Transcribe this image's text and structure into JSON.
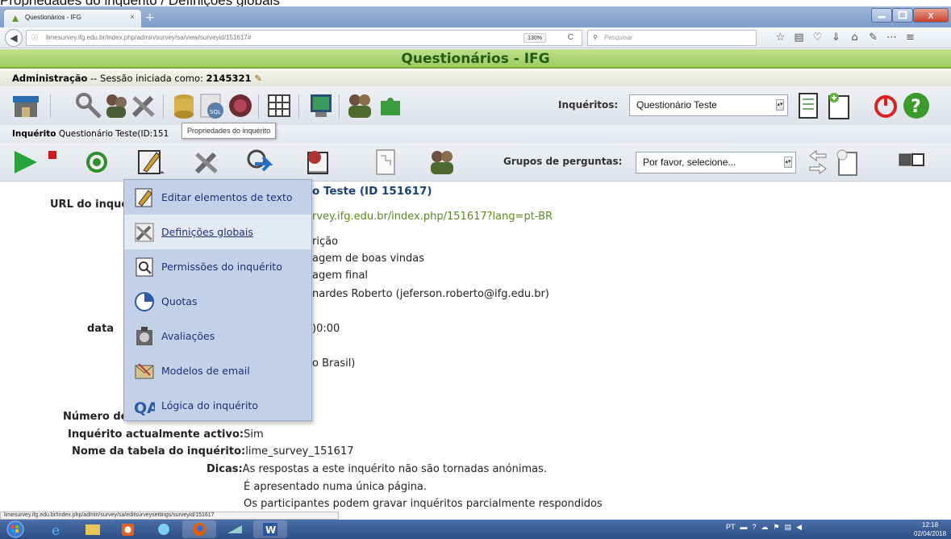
{
  "doc_caption": "Propriedades do inquérito / Definições globais",
  "browser": {
    "tab_title": "Questionários - IFG",
    "tab_close": "×",
    "new_tab": "+",
    "win_close": "x",
    "url": "limesurvey.ifg.edu.br/index.php/admin/survey/sa/view/surveyid/151617#",
    "zoom": "130%",
    "search_placeholder": "Pesquisar",
    "status_url": "limesurvey.ifg.edu.br/index.php/admin/survey/sa/editsurveysettings/surveyid/151617"
  },
  "app": {
    "title": "Questionários - IFG",
    "admin_prefix": "Administração",
    "session_text": "-- Sessão iniciada como:",
    "user_id": "2145321",
    "surveys_label": "Inquéritos:",
    "selected_survey": "Questionário Teste",
    "survey_line_prefix": "Inquérito",
    "survey_line_value": "Questionário Teste(ID:151",
    "tooltip": "Propriedades do inquérito",
    "groups_label": "Grupos de perguntas:",
    "groups_select": "Por favor, selecione..."
  },
  "menu": {
    "items": [
      {
        "label": "Editar elementos de texto",
        "icon": "edit-text-icon"
      },
      {
        "label": "Definições globais",
        "icon": "global-settings-icon"
      },
      {
        "label": "Permissões do inquérito",
        "icon": "permissions-icon"
      },
      {
        "label": "Quotas",
        "icon": "quotas-icon"
      },
      {
        "label": "Avaliações",
        "icon": "assessments-icon"
      },
      {
        "label": "Modelos de email",
        "icon": "email-templates-icon"
      },
      {
        "label": "Lógica do inquérito",
        "icon": "survey-logic-icon"
      }
    ]
  },
  "content": {
    "heading_tail": "o Teste (ID 151617)",
    "url_label": "URL do inqué",
    "url_value": "rvey.ifg.edu.br/index.php/151617?lang=pt-BR",
    "line_descricao": "rição",
    "line_boas_vindas": "agem de boas vindas",
    "line_final": "agem final",
    "line_admin": "nardes Roberto (jeferson.roberto@ifg.edu.br)",
    "data_label": "data",
    "data_value": ")0:00",
    "lang_value": "o Brasil)",
    "num_label": "Número de",
    "active_label": "Inquérito actualmente activo:",
    "active_value": "Sim",
    "table_label": "Nome da tabela do inquérito:",
    "table_value": "lime_survey_151617",
    "hints_label": "Dicas:",
    "hint1": "As respostas a este inquérito não são tornadas anónimas.",
    "hint2": "É apresentado numa única página.",
    "hint3": "Os participantes podem gravar inquéritos parcialmente respondidos"
  },
  "taskbar": {
    "lang": "PT",
    "time": "12:18",
    "date": "02/04/2018"
  }
}
